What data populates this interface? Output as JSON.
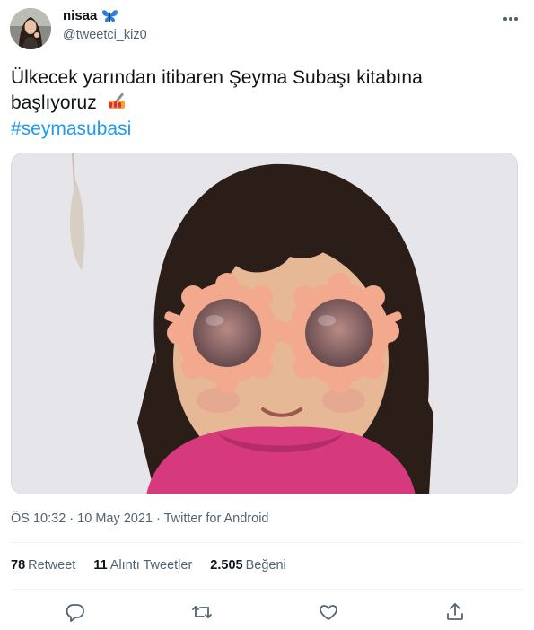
{
  "user": {
    "display_name": "nisaa",
    "name_emoji": "butterfly-emoji",
    "handle": "@tweetci_kiz0"
  },
  "tweet": {
    "text": "Ülkecek yarından itibaren Şeyma Subaşı kitabına başlıyoruz",
    "text_emoji": "nail-polish-emoji",
    "hashtag": "#seymasubasi",
    "media_description_icon": "photo"
  },
  "meta": {
    "time": "ÖS 10:32",
    "date": "10 May 2021",
    "source": "Twitter for Android",
    "separator": " · "
  },
  "stats": {
    "retweets_count": "78",
    "retweets_label": "Retweet",
    "quotes_count": "11",
    "quotes_label": "Alıntı Tweetler",
    "likes_count": "2.505",
    "likes_label": "Beğeni"
  },
  "icons": {
    "reply": "reply-icon",
    "retweet": "retweet-icon",
    "like": "like-icon",
    "share": "share-icon",
    "more": "more-icon"
  },
  "colors": {
    "link": "#1d9bf0",
    "secondary_text": "#536471",
    "primary_text": "#0f1419",
    "border": "#cfd9de"
  }
}
